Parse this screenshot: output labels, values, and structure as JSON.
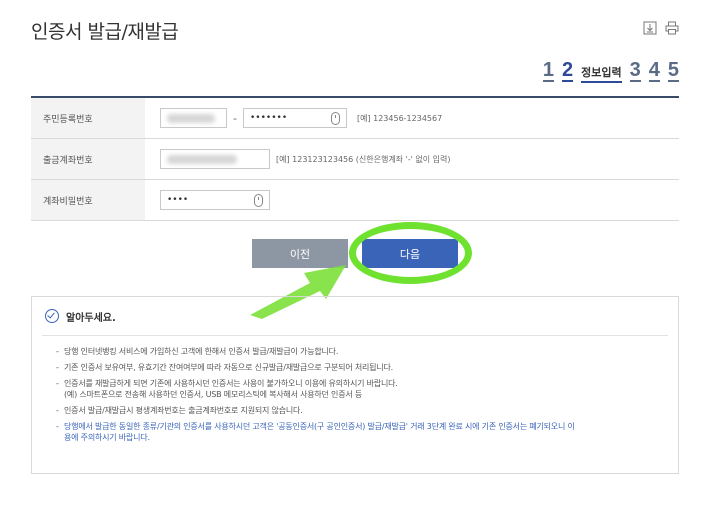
{
  "page": {
    "title": "인증서 발급/재발급"
  },
  "icons": [
    "download-icon",
    "print-icon"
  ],
  "steps": {
    "items": [
      {
        "num": "1",
        "label": ""
      },
      {
        "num": "2",
        "label": "정보입력"
      },
      {
        "num": "3",
        "label": ""
      },
      {
        "num": "4",
        "label": ""
      },
      {
        "num": "5",
        "label": ""
      }
    ],
    "active": 2
  },
  "form": {
    "rows": [
      {
        "label": "주민등록번호",
        "value1": "",
        "value2": "•••••••",
        "hint": "[예] 123456-1234567"
      },
      {
        "label": "출금계좌번호",
        "value1": "",
        "hint": "[예] 123123123456 (신한은행계좌 '-' 없이 입력)"
      },
      {
        "label": "계좌비밀번호",
        "value1": "••••"
      }
    ],
    "separator": "-"
  },
  "buttons": {
    "prev": "이전",
    "next": "다음"
  },
  "colors": {
    "accent": "#3a64b8",
    "highlight": "#6fe12f",
    "prev_button": "#8d97a4"
  },
  "notice": {
    "title": "알아두세요.",
    "items": [
      {
        "lines": [
          "당행 인터넷뱅킹 서비스에 가입하신 고객에 한해서 인증서 발급/재발급이 가능합니다."
        ]
      },
      {
        "lines": [
          "기존 인증서 보유여부, 유효기간 잔여여부에 따라 자동으로 신규발급/재발급으로 구분되어 처리됩니다."
        ]
      },
      {
        "lines": [
          "인증서를 재발급하게 되면 기존에 사용하시던 인증서는 사용이 불가하오니 이용에 유의하시기 바랍니다.",
          "(예) 스마트폰으로 전송해 사용하던 인증서, USB 메모리스틱에 복사해서 사용하던 인증서 등"
        ]
      },
      {
        "lines": [
          "인증서 발급/재발급시 평생계좌번호는 출금계좌번호로 지원되지 않습니다."
        ]
      },
      {
        "lines": [
          "당행에서 발급한 동일한 종류/기관의 인증서를 사용하시던 고객은 '공동인증서(구 공인인증서) 발급/재발급' 거래 3단계 완료 시에 기존 인증서는 폐기되오니 이",
          "용에 주의하시기 바랍니다."
        ]
      }
    ]
  }
}
